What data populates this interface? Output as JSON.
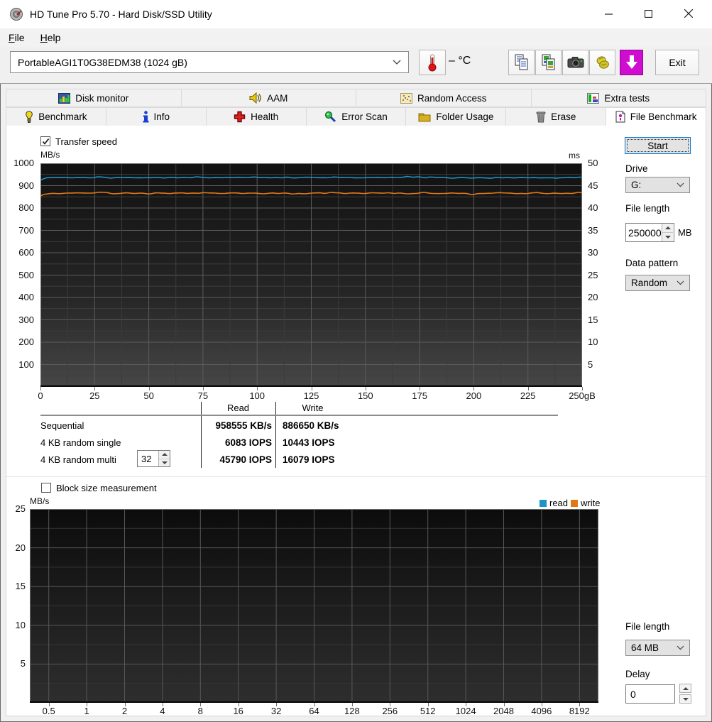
{
  "window": {
    "title": "HD Tune Pro 5.70 - Hard Disk/SSD Utility",
    "app_icon": "hd-tune-logo-icon",
    "controls": [
      "minimize",
      "maximize",
      "close"
    ]
  },
  "menu": {
    "file": {
      "initial": "F",
      "rest": "ile"
    },
    "help": {
      "initial": "H",
      "rest": "elp"
    }
  },
  "toolbar": {
    "drive_selector_value": "PortableAGI1T0G38EDM38 (1024 gB)",
    "temperature_value": "– °C",
    "buttons": [
      "thermometer-icon",
      "copy-text-icon",
      "copy-image-icon",
      "camera-icon",
      "hands-icon",
      "download-icon"
    ],
    "exit_label": "Exit"
  },
  "tabs_row1": [
    {
      "label": "Disk monitor",
      "icon": "disk-monitor-icon"
    },
    {
      "label": "AAM",
      "icon": "speaker-icon"
    },
    {
      "label": "Random Access",
      "icon": "scatter-icon"
    },
    {
      "label": "Extra tests",
      "icon": "extra-tests-icon"
    }
  ],
  "tabs_row2": [
    {
      "label": "Benchmark",
      "icon": "benchmark-icon"
    },
    {
      "label": "Info",
      "icon": "info-icon"
    },
    {
      "label": "Health",
      "icon": "health-icon"
    },
    {
      "label": "Error Scan",
      "icon": "error-scan-icon"
    },
    {
      "label": "Folder Usage",
      "icon": "folder-icon"
    },
    {
      "label": "Erase",
      "icon": "trash-icon"
    },
    {
      "label": "File Benchmark",
      "icon": "file-benchmark-icon",
      "active": true
    }
  ],
  "panel": {
    "transfer_speed_label": "Transfer speed",
    "transfer_speed_checked": true,
    "block_size_label": "Block size measurement",
    "block_size_checked": false,
    "start_button": "Start",
    "drive_label": "Drive",
    "drive_value": "G:",
    "file_length_label": "File length",
    "file_length_value": "250000",
    "file_length_unit": "MB",
    "data_pattern_label": "Data pattern",
    "data_pattern_value": "Random",
    "file_length2_label": "File length",
    "file_length2_value": "64 MB",
    "delay_label": "Delay",
    "delay_value": "0",
    "legend_read": "read",
    "legend_write": "write",
    "legend_read_color": "#1b95c8",
    "legend_write_color": "#e07818"
  },
  "results": {
    "read_header": "Read",
    "write_header": "Write",
    "rows": [
      {
        "label": "Sequential",
        "read": "958555 KB/s",
        "write": "886650 KB/s"
      },
      {
        "label": "4 KB random single",
        "read": "6083 IOPS",
        "write": "10443 IOPS"
      },
      {
        "label": "4 KB random multi",
        "queue_depth": "32",
        "read": "45790 IOPS",
        "write": "16079 IOPS"
      }
    ]
  },
  "chart_data": [
    {
      "type": "line",
      "title": "Transfer speed",
      "ylabel": "MB/s",
      "ylabel_right": "ms",
      "xlim": [
        0,
        250
      ],
      "x_ticks": [
        0,
        25,
        50,
        75,
        100,
        125,
        150,
        175,
        200,
        225,
        250
      ],
      "x_last_suffix": "gB",
      "ylim": [
        0,
        1000
      ],
      "y_ticks": [
        100,
        200,
        300,
        400,
        500,
        600,
        700,
        800,
        900,
        1000
      ],
      "y2lim": [
        0,
        50
      ],
      "y2_ticks": [
        5,
        10,
        15,
        20,
        25,
        30,
        35,
        40,
        45,
        50
      ],
      "grid": true,
      "series": [
        {
          "name": "read",
          "color": "#1b95c8",
          "avg_mbs": 936,
          "wobble": 4,
          "shape": "flat"
        },
        {
          "name": "write",
          "color": "#e07818",
          "avg_mbs": 866,
          "wobble": 5,
          "shape": "flat"
        }
      ]
    },
    {
      "type": "line",
      "title": "Block size measurement",
      "ylabel": "MB/s",
      "xscale": "log2",
      "x_ticks": [
        0.5,
        1,
        2,
        4,
        8,
        16,
        32,
        64,
        128,
        256,
        512,
        1024,
        2048,
        4096,
        8192
      ],
      "ylim": [
        0,
        25
      ],
      "y_ticks": [
        5,
        10,
        15,
        20,
        25
      ],
      "grid": true,
      "legend": [
        "read",
        "write"
      ],
      "legend_position": "top-right",
      "series": []
    }
  ]
}
